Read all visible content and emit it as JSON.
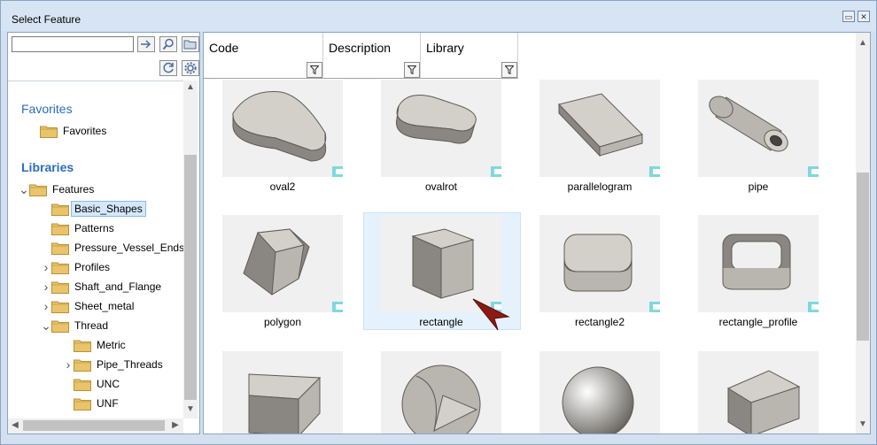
{
  "window": {
    "title": "Select Feature"
  },
  "left": {
    "search": {
      "value": "",
      "placeholder": ""
    },
    "favorites_title": "Favorites",
    "favorites_items": [
      {
        "label": "Favorites"
      }
    ],
    "libraries_title": "Libraries",
    "tree": [
      {
        "label": "Features",
        "expanded": true,
        "indent": 0,
        "has_arrow": true
      },
      {
        "label": "Basic_Shapes",
        "indent": 1,
        "selected": true,
        "has_arrow": false
      },
      {
        "label": "Patterns",
        "indent": 1,
        "has_arrow": false
      },
      {
        "label": "Pressure_Vessel_Ends",
        "indent": 1,
        "has_arrow": false
      },
      {
        "label": "Profiles",
        "indent": 1,
        "has_arrow": true,
        "expanded": false
      },
      {
        "label": "Shaft_and_Flange",
        "indent": 1,
        "has_arrow": true,
        "expanded": false
      },
      {
        "label": "Sheet_metal",
        "indent": 1,
        "has_arrow": true,
        "expanded": false
      },
      {
        "label": "Thread",
        "indent": 1,
        "has_arrow": true,
        "expanded": true
      },
      {
        "label": "Metric",
        "indent": 2,
        "has_arrow": false
      },
      {
        "label": "Pipe_Threads",
        "indent": 2,
        "has_arrow": true,
        "expanded": false
      },
      {
        "label": "UNC",
        "indent": 2,
        "has_arrow": false
      },
      {
        "label": "UNF",
        "indent": 2,
        "has_arrow": false
      }
    ]
  },
  "columns": [
    {
      "label": "Code"
    },
    {
      "label": "Description"
    },
    {
      "label": "Library"
    }
  ],
  "tiles": [
    {
      "label": "oval2",
      "shape": "oval2"
    },
    {
      "label": "ovalrot",
      "shape": "ovalrot"
    },
    {
      "label": "parallelogram",
      "shape": "parallelogram"
    },
    {
      "label": "pipe",
      "shape": "pipe"
    },
    {
      "label": "polygon",
      "shape": "polygon"
    },
    {
      "label": "rectangle",
      "shape": "rectangle",
      "selected": true
    },
    {
      "label": "rectangle2",
      "shape": "rectangle2"
    },
    {
      "label": "rectangle_profile",
      "shape": "rectangle_profile"
    },
    {
      "label": "",
      "shape": "wedge"
    },
    {
      "label": "",
      "shape": "sphere_cut"
    },
    {
      "label": "",
      "shape": "sphere"
    },
    {
      "label": "",
      "shape": "trapezoid"
    }
  ],
  "colors": {
    "accent": "#2b6cbf",
    "selection": "#d5e8fb",
    "badge": "#7ed8df",
    "folder": "#e9c46a"
  }
}
